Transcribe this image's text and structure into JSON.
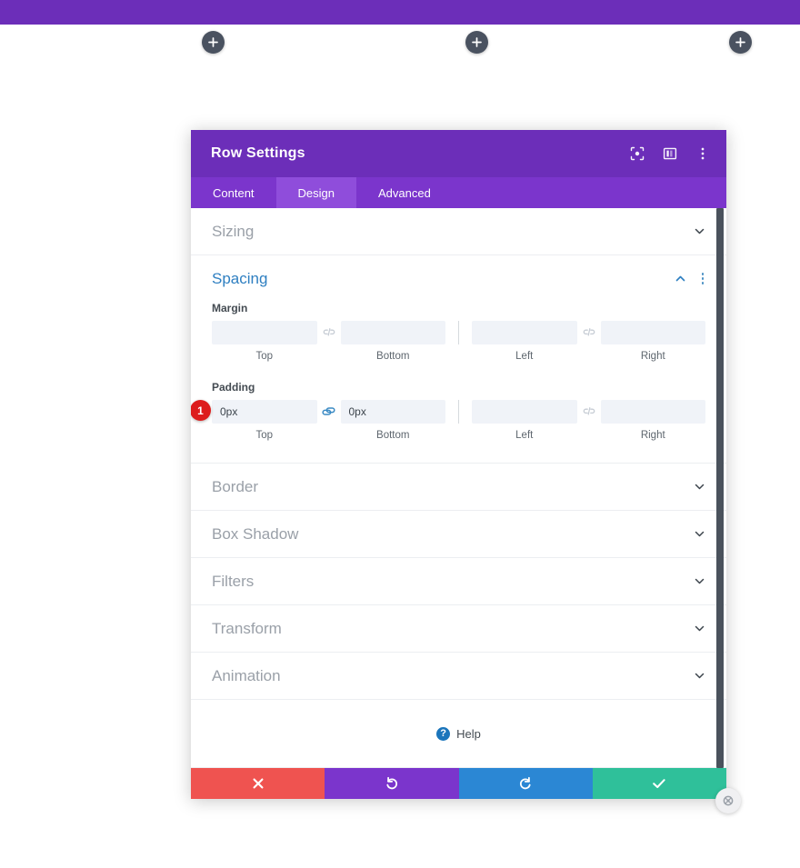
{
  "top_bar": {
    "color": "#6c2eb9"
  },
  "canvas": {
    "add_buttons": [
      {
        "name": "add-section-left",
        "label": "+"
      },
      {
        "name": "add-section-center",
        "label": "+"
      },
      {
        "name": "add-section-right",
        "label": "+"
      }
    ]
  },
  "modal": {
    "title": "Row Settings",
    "header_icons": [
      {
        "name": "focus-icon",
        "title": "Focus"
      },
      {
        "name": "layout-columns-icon",
        "title": "Layout"
      },
      {
        "name": "more-options-icon",
        "title": "More"
      }
    ],
    "tabs": [
      {
        "label": "Content",
        "active": false
      },
      {
        "label": "Design",
        "active": true
      },
      {
        "label": "Advanced",
        "active": false
      }
    ],
    "edge_handle": {
      "name": "settings-handle-icon"
    },
    "sections": [
      {
        "label": "Sizing",
        "open": false
      },
      {
        "label": "Spacing",
        "open": true
      },
      {
        "label": "Border",
        "open": false
      },
      {
        "label": "Box Shadow",
        "open": false
      },
      {
        "label": "Filters",
        "open": false
      },
      {
        "label": "Transform",
        "open": false
      },
      {
        "label": "Animation",
        "open": false
      }
    ],
    "spacing": {
      "margin": {
        "label": "Margin",
        "top": {
          "value": "",
          "placeholder": "",
          "sub": "Top"
        },
        "bottom": {
          "value": "",
          "placeholder": "",
          "sub": "Bottom"
        },
        "left": {
          "value": "",
          "placeholder": "",
          "sub": "Left"
        },
        "right": {
          "value": "",
          "placeholder": "",
          "sub": "Right"
        },
        "link_tb": "unlinked",
        "link_lr": "unlinked"
      },
      "padding": {
        "label": "Padding",
        "badge": "1",
        "top": {
          "value": "0px",
          "placeholder": "",
          "sub": "Top"
        },
        "bottom": {
          "value": "0px",
          "placeholder": "",
          "sub": "Bottom"
        },
        "left": {
          "value": "",
          "placeholder": "",
          "sub": "Left"
        },
        "right": {
          "value": "",
          "placeholder": "",
          "sub": "Right"
        },
        "link_tb": "linked",
        "link_lr": "unlinked"
      }
    },
    "help": {
      "label": "Help",
      "icon": "?"
    },
    "footer": [
      {
        "name": "cancel-button",
        "icon": "close-icon",
        "color": "#ef5350"
      },
      {
        "name": "undo-button",
        "icon": "undo-icon",
        "color": "#7b35cc"
      },
      {
        "name": "redo-button",
        "icon": "redo-icon",
        "color": "#2b87d4"
      },
      {
        "name": "save-button",
        "icon": "checkmark-icon",
        "color": "#2fc09a"
      }
    ]
  },
  "colors": {
    "brand_purple": "#6c2eb9",
    "tab_bar": "#7b35cc",
    "tab_active": "#8f4ddb",
    "accent_blue": "#2e7fc1",
    "badge_red": "#dd1c1c",
    "scrollbar": "#4a525c"
  }
}
